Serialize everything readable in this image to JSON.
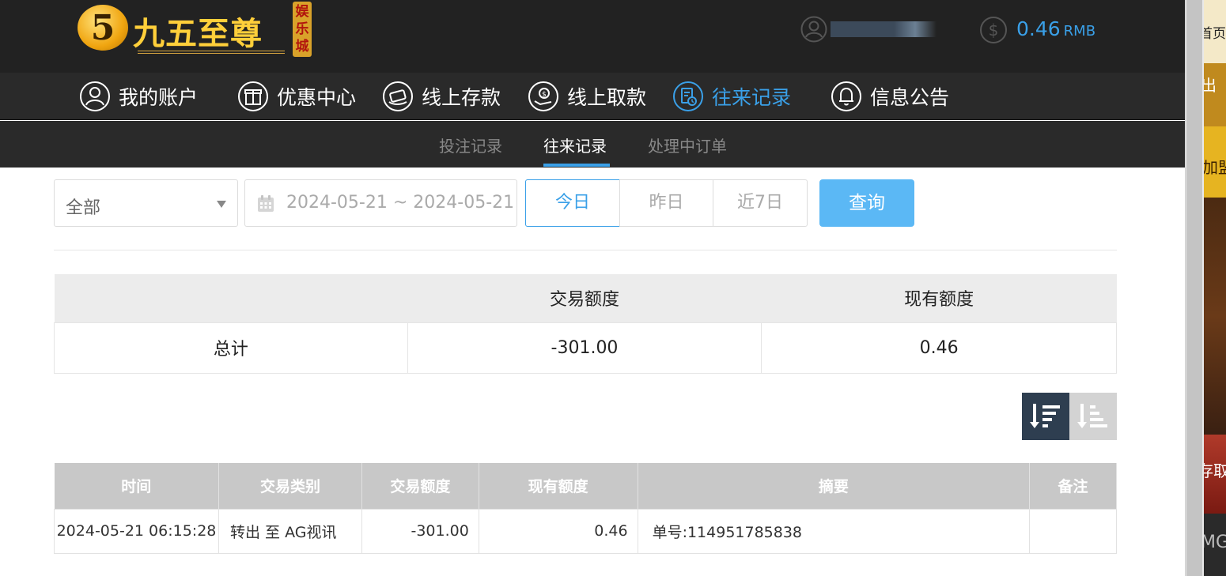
{
  "brand": {
    "logo_mark": "5",
    "name": "九五至尊",
    "badge": "娱乐城"
  },
  "header": {
    "username": "••••••",
    "balance_value": "0.46",
    "balance_currency": "RMB"
  },
  "main_nav": [
    {
      "label": "我的账户",
      "icon": "user-icon",
      "active": false
    },
    {
      "label": "优惠中心",
      "icon": "gift-icon",
      "active": false
    },
    {
      "label": "线上存款",
      "icon": "deposit-icon",
      "active": false
    },
    {
      "label": "线上取款",
      "icon": "withdraw-icon",
      "active": false
    },
    {
      "label": "往来记录",
      "icon": "records-icon",
      "active": true
    },
    {
      "label": "信息公告",
      "icon": "bell-icon",
      "active": false
    }
  ],
  "sub_nav": [
    {
      "label": "投注记录",
      "active": false
    },
    {
      "label": "往来记录",
      "active": true
    },
    {
      "label": "处理中订单",
      "active": false
    }
  ],
  "filters": {
    "type_value": "全部",
    "date_range": "2024-05-21 ~ 2024-05-21",
    "quick_ranges": [
      "今日",
      "昨日",
      "近7日"
    ],
    "quick_active": "今日",
    "query_label": "查询"
  },
  "summary": {
    "headers": [
      "",
      "交易额度",
      "现有额度"
    ],
    "row": [
      "总计",
      "-301.00",
      "0.46"
    ]
  },
  "sort": {
    "desc_icon": "sort-descending-icon",
    "asc_icon": "sort-ascending-icon",
    "active": "desc"
  },
  "transactions": {
    "headers": [
      "时间",
      "交易类别",
      "交易额度",
      "现有额度",
      "摘要",
      "备注"
    ],
    "rows": [
      {
        "time": "2024-05-21 06:15:28",
        "type": "转出 至 AG视讯",
        "amount": "-301.00",
        "balance": "0.46",
        "summary": "单号:114951785838",
        "note": ""
      }
    ]
  },
  "side_panel": [
    "首页",
    "出",
    "加盟",
    "存取",
    "MG"
  ],
  "colors": {
    "accent": "#3aa0e8",
    "header_bg": "#222222",
    "nav_bg": "#2a2a2a",
    "query_button": "#5bb8f5",
    "sort_active": "#2e3e50",
    "table_header": "#c8c8c8",
    "logo_gold": "#ffcf3a"
  }
}
